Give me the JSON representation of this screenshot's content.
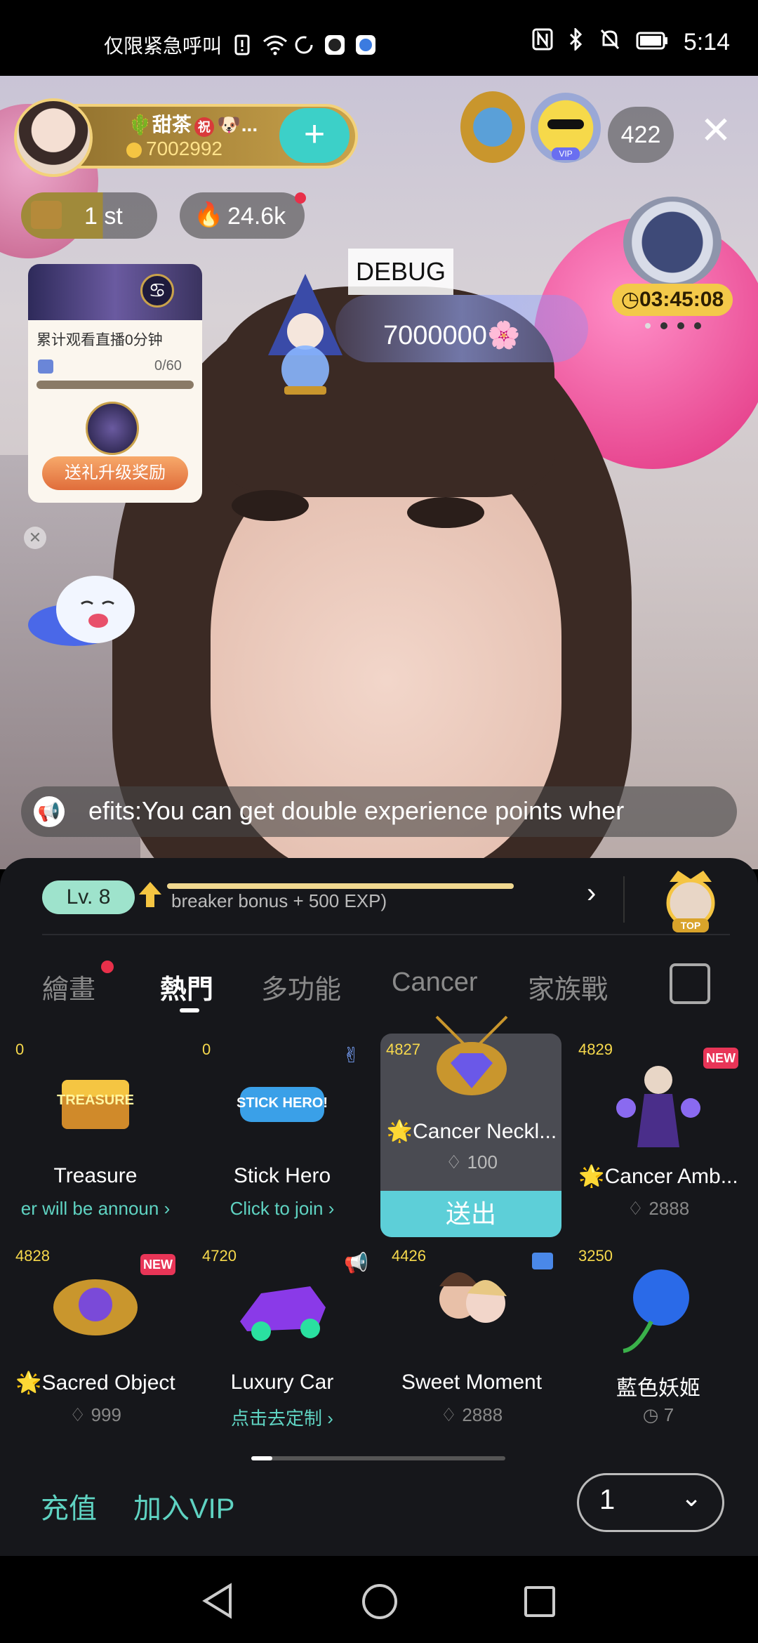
{
  "status_bar": {
    "left_text": "仅限紧急呼叫",
    "time": "5:14"
  },
  "host": {
    "name": "甜茶",
    "badge_char": "祝",
    "name_suffix": "...",
    "id": "7002992",
    "follow_label": "+"
  },
  "top_right": {
    "viewer_count": "422",
    "vip_label": "VIP",
    "close_label": "✕"
  },
  "stats": {
    "rank": "1 st",
    "heat": "24.6k",
    "timer": "03:45:08"
  },
  "watch_card": {
    "title": "累计观看直播0分钟",
    "progress": "0/60",
    "button": "送礼升级奖励"
  },
  "debug_label": "DEBUG",
  "score": "7000000",
  "ticker_text": "efits:You can get double experience points wher",
  "level_bar": {
    "level": "Lv. 8",
    "exp_text": "breaker bonus + 500 EXP)",
    "top_label": "TOP"
  },
  "tabs": [
    {
      "label": "繪畫"
    },
    {
      "label": "熱門"
    },
    {
      "label": "多功能"
    },
    {
      "label": "Cancer"
    },
    {
      "label": "家族戰"
    }
  ],
  "gifts": [
    {
      "count": "0",
      "name": "Treasure",
      "sub": "er will be announ",
      "sub_arrow": "›",
      "img_label": "TREASURE"
    },
    {
      "count": "0",
      "name": "Stick Hero",
      "sub": "Click to join",
      "sub_arrow": "›",
      "img_label": "STICK HERO!"
    },
    {
      "count": "4827",
      "name": "🌟Cancer Neckl...",
      "price": "100",
      "send": "送出"
    },
    {
      "count": "4829",
      "name": "🌟Cancer Amb...",
      "price": "2888",
      "new": "NEW"
    },
    {
      "count": "4828",
      "name": "🌟Sacred Object",
      "price": "999",
      "new": "NEW"
    },
    {
      "count": "4720",
      "name": "Luxury Car",
      "sub": "点击去定制",
      "sub_arrow": "›"
    },
    {
      "count": "4426",
      "name": "Sweet Moment",
      "price": "2888"
    },
    {
      "count": "3250",
      "name": "藍色妖姬",
      "price": "7"
    }
  ],
  "bottom": {
    "recharge": "充值",
    "join_vip": "加入VIP",
    "quantity": "1"
  },
  "colors": {
    "accent_teal": "#5dcfd8",
    "text_teal": "#5fd3c2",
    "gift_count": "#f7d94c",
    "panel_bg": "#16171b"
  }
}
